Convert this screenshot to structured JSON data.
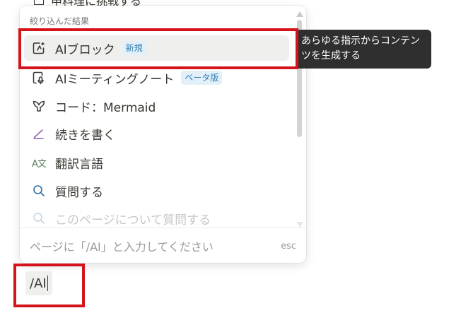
{
  "background_text": "申料理に挑戦する",
  "menu": {
    "header": "絞り込んだ結果",
    "items": [
      {
        "label": "AIブロック",
        "badge": "新規",
        "icon": "ai-block-icon",
        "selected": true
      },
      {
        "label": "AIミーティングノート",
        "badge": "ベータ版",
        "icon": "meeting-notes-icon"
      },
      {
        "label": "コード：Mermaid",
        "icon": "mermaid-icon"
      },
      {
        "label": "続きを書く",
        "icon": "pen-icon"
      },
      {
        "label": "翻訳言語",
        "icon": "translate-icon",
        "icon_text": "A文"
      },
      {
        "label": "質問する",
        "icon": "search-icon"
      },
      {
        "label": "このページについて質問する",
        "icon": "search-icon"
      }
    ],
    "footer_hint": "ページに「/AI」と入力してください",
    "footer_esc": "esc"
  },
  "tooltip": "あらゆる指示からコンテンツを生成する",
  "editor": {
    "typed_text": "/AI"
  },
  "colors": {
    "highlight": "#d3141b",
    "badge_text": "#2e7dad",
    "badge_bg": "#e3f0fa",
    "tooltip_bg": "#2f2f2f",
    "pen_accent": "#9065b0"
  }
}
